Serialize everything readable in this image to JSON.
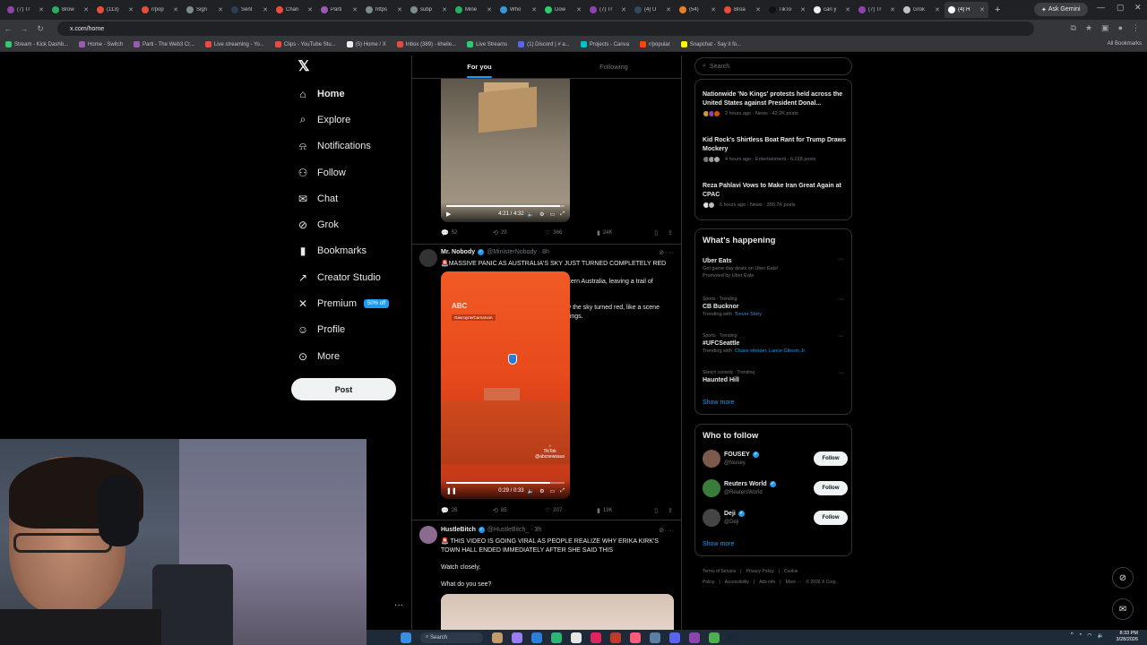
{
  "browser": {
    "tabs": [
      {
        "title": "(7) Tr",
        "color": "#8e44ad"
      },
      {
        "title": "Brow",
        "color": "#27ae60"
      },
      {
        "title": "(113)",
        "color": "#e74c3c"
      },
      {
        "title": "r/pop",
        "color": "#e74c3c"
      },
      {
        "title": "Sign",
        "color": "#7f8c8d"
      },
      {
        "title": "Sent",
        "color": "#2c3e50"
      },
      {
        "title": "Chan",
        "color": "#e74c3c"
      },
      {
        "title": "Parti",
        "color": "#9b59b6"
      },
      {
        "title": "https",
        "color": "#7f8c8d"
      },
      {
        "title": "subp",
        "color": "#7f8c8d"
      },
      {
        "title": "Mine",
        "color": "#27ae60"
      },
      {
        "title": "Who",
        "color": "#3498db"
      },
      {
        "title": "Dow",
        "color": "#2ecc71"
      },
      {
        "title": "(7) Tr",
        "color": "#8e44ad"
      },
      {
        "title": "(4) U",
        "color": "#34495e"
      },
      {
        "title": "(54)",
        "color": "#e67e22"
      },
      {
        "title": "Broa",
        "color": "#e74c3c"
      },
      {
        "title": "TikTo",
        "color": "#111"
      },
      {
        "title": "can y",
        "color": "#ecf0f1"
      },
      {
        "title": "(7) Tr",
        "color": "#8e44ad"
      },
      {
        "title": "Grok",
        "color": "#bdc3c7"
      },
      {
        "title": "(4) H",
        "color": "#ffffff"
      }
    ],
    "gemini_label": "Ask Gemini",
    "url": "x.com/home",
    "bookmarks": [
      {
        "label": "Stream - Kick Dashb...",
        "color": "#2ecc71"
      },
      {
        "label": "Home - Switch",
        "color": "#9b59b6"
      },
      {
        "label": "Parti - The Web3 Cr...",
        "color": "#9b59b6"
      },
      {
        "label": "Live streaming - Yo...",
        "color": "#e74c3c"
      },
      {
        "label": "Clips - YouTube Stu...",
        "color": "#e74c3c"
      },
      {
        "label": "(5) Home / X",
        "color": "#ecf0f1"
      },
      {
        "label": "Inbox (389) - kheile...",
        "color": "#e74c3c"
      },
      {
        "label": "Live Streams",
        "color": "#2ecc71"
      },
      {
        "label": "(1) Discord | #⁠ a...",
        "color": "#5865f2"
      },
      {
        "label": "Projects - Canva",
        "color": "#00c4cc"
      },
      {
        "label": "r/popular",
        "color": "#ff4500"
      },
      {
        "label": "Snapchat - Say it fo...",
        "color": "#fffc00"
      }
    ],
    "all_bookmarks": "All Bookmarks"
  },
  "nav": {
    "items": [
      {
        "label": "Home",
        "icon": "home-icon",
        "glyph": "⌂"
      },
      {
        "label": "Explore",
        "icon": "search-icon",
        "glyph": "⌕"
      },
      {
        "label": "Notifications",
        "icon": "bell-icon",
        "glyph": "⍾"
      },
      {
        "label": "Follow",
        "icon": "follow-icon",
        "glyph": "⚇"
      },
      {
        "label": "Chat",
        "icon": "chat-icon",
        "glyph": "✉"
      },
      {
        "label": "Grok",
        "icon": "grok-icon",
        "glyph": "⊘"
      },
      {
        "label": "Bookmarks",
        "icon": "bookmark-icon",
        "glyph": "▮"
      },
      {
        "label": "Creator Studio",
        "icon": "rocket-icon",
        "glyph": "↗"
      },
      {
        "label": "Premium",
        "icon": "x-icon",
        "glyph": "✕"
      },
      {
        "label": "Profile",
        "icon": "profile-icon",
        "glyph": "☺"
      },
      {
        "label": "More",
        "icon": "more-icon",
        "glyph": "⊙"
      }
    ],
    "premium_badge": "50% off",
    "post_label": "Post"
  },
  "timeline": {
    "tabs": [
      "For you",
      "Following"
    ],
    "tweet0": {
      "video_time": "4:21 / 4:32",
      "progress": 0.96,
      "replies": "52",
      "reposts": "29",
      "likes": "366",
      "views": "24K"
    },
    "tweet1": {
      "name": "Mr. Nobody",
      "handle": "@MinisterNobody · 8h",
      "headline": "🚨MASSIVE PANIC AS AUSTRALIA'S SKY JUST TURNED COMPLETELY RED",
      "para1": "Cyclone Narelle officially made landfall in Western Australia, leaving a trail of destruction, but one question remains.",
      "para2": "Residents are scratching their heads as to why the sky turned red, like a scene straight out of the Upside Down in Stranger Things.",
      "video_logo": "ABC",
      "video_tag": "Gascoyne/Carnarvon",
      "tiktok": "TikTok",
      "tiktok_handle": "@abcnewsaus",
      "video_time": "0:29 / 0:33",
      "progress": 0.88,
      "replies": "26",
      "reposts": "85",
      "likes": "207",
      "views": "19K"
    },
    "tweet2": {
      "name": "HustleBitch",
      "handle": "@HustleBitch_ · 3h",
      "headline": "🚨 THIS VIDEO IS GOING VIRAL AS PEOPLE REALIZE WHY ERIKA KIRK'S TOWN HALL ENDED IMMEDIATELY AFTER SHE SAID THIS",
      "para1": "Watch closely.",
      "para2": "What do you see?"
    }
  },
  "sidebar": {
    "search_placeholder": "Search",
    "news": [
      {
        "title": "Nationwide 'No Kings' protests held across the United States against President Donal...",
        "meta": "2 hours ago · News · 42.2K posts"
      },
      {
        "title": "Kid Rock's Shirtless Boat Rant for Trump Draws Mockery",
        "meta": "4 hours ago · Entertainment · 6,018 posts"
      },
      {
        "title": "Reza Pahlavi Vows to Make Iran Great Again at CPAC",
        "meta": "6 hours ago · News · 350.7K posts"
      }
    ],
    "happening_title": "What's happening",
    "trends": [
      {
        "context": "",
        "name": "Uber Eats",
        "sub": "Get game day deals on Uber Eats!",
        "sub2": "Promoted by Uber Eats",
        "link": ""
      },
      {
        "context": "Sports · Trending",
        "name": "CB Bucknor",
        "sub": "Trending with",
        "sub2": "",
        "link": "Trevor Story"
      },
      {
        "context": "Sports · Trending",
        "name": "#UFCSeattle",
        "sub": "Trending with",
        "sub2": "",
        "link": "Chase Hooper, Lance Gibson Jr."
      },
      {
        "context": "Sketch comedy · Trending",
        "name": "Haunted Hill",
        "sub": "",
        "sub2": "",
        "link": ""
      }
    ],
    "show_more": "Show more",
    "wtf_title": "Who to follow",
    "follow": [
      {
        "name": "FOUSEY",
        "handle": "@fousey",
        "color": "#7b5a4b"
      },
      {
        "name": "Reuters World",
        "handle": "@ReutersWorld",
        "color": "#3a7d3a"
      },
      {
        "name": "Deji",
        "handle": "@Deji",
        "color": "#444"
      }
    ],
    "follow_label": "Follow",
    "footer": [
      "Terms of Service",
      "|",
      "Privacy Policy",
      "|",
      "Cookie Policy",
      "|",
      "Accessibility",
      "|",
      "Ads info",
      "|",
      "More ···",
      "© 2026 X Corp."
    ]
  },
  "taskbar": {
    "search_label": "Search",
    "time": "8:33 PM",
    "date": "3/28/2026"
  }
}
